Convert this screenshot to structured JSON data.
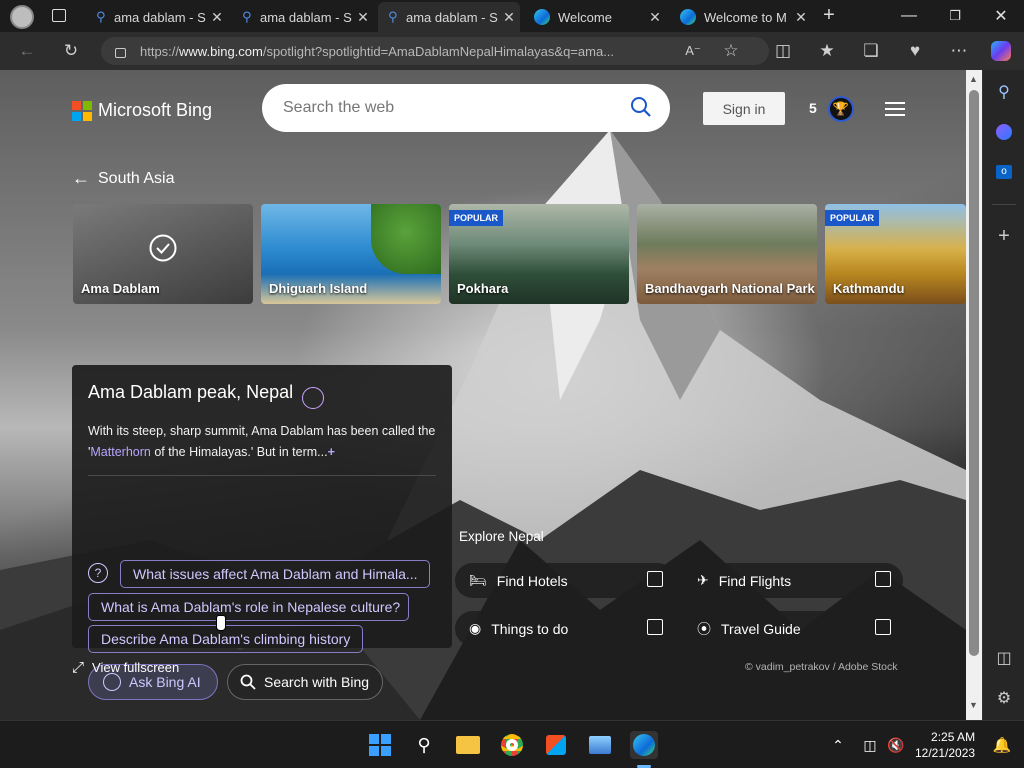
{
  "browser": {
    "tabs": [
      {
        "label": "ama dablam - S",
        "icon": "search-icon",
        "active": false
      },
      {
        "label": "ama dablam - S",
        "icon": "search-icon",
        "active": false
      },
      {
        "label": "ama dablam - S",
        "icon": "search-icon",
        "active": true
      },
      {
        "label": "Welcome",
        "icon": "edge-icon",
        "active": false
      },
      {
        "label": "Welcome to M",
        "icon": "edge-icon",
        "active": false
      }
    ],
    "url_prefix": "https://",
    "url_domain": "www.bing.com",
    "url_rest": "/spotlight?spotlightid=AmaDablamNepalHimalayas&q=ama..."
  },
  "bing": {
    "logo_text": "Microsoft Bing",
    "search_placeholder": "Search the web",
    "signin_label": "Sign in",
    "rewards_count": "5"
  },
  "breadcrumb": {
    "label": "South Asia"
  },
  "carousel": [
    {
      "label": "Ama Dablam",
      "selected": true,
      "badge": ""
    },
    {
      "label": "Dhiguarh Island",
      "selected": false,
      "badge": ""
    },
    {
      "label": "Pokhara",
      "selected": false,
      "badge": "POPULAR"
    },
    {
      "label": "Bandhavgarh National Park",
      "selected": false,
      "badge": ""
    },
    {
      "label": "Kathmandu",
      "selected": false,
      "badge": "POPULAR"
    }
  ],
  "info": {
    "title": "Ama Dablam peak, Nepal",
    "desc_before": "With its steep, sharp summit, Ama Dablam has been called the '",
    "desc_link": "Matterhorn",
    "desc_after": " of the Himalayas.' But in term...",
    "more": "+",
    "chips": [
      "What issues affect Ama Dablam and Himala...",
      "What is Ama Dablam's role in Nepalese culture?",
      "Describe Ama Dablam's climbing history"
    ],
    "ask_label": "Ask Bing AI",
    "search_label": "Search with Bing"
  },
  "fullscreen_label": "View fullscreen",
  "explore": {
    "title": "Explore Nepal",
    "actions": [
      {
        "label": "Find Hotels",
        "icon": "bed-icon"
      },
      {
        "label": "Find Flights",
        "icon": "plane-icon"
      },
      {
        "label": "Things to do",
        "icon": "binoculars-icon"
      },
      {
        "label": "Travel Guide",
        "icon": "compass-icon"
      }
    ]
  },
  "credit": "© vadim_petrakov / Adobe Stock",
  "taskbar": {
    "time": "2:25 AM",
    "date": "12/21/2023"
  }
}
